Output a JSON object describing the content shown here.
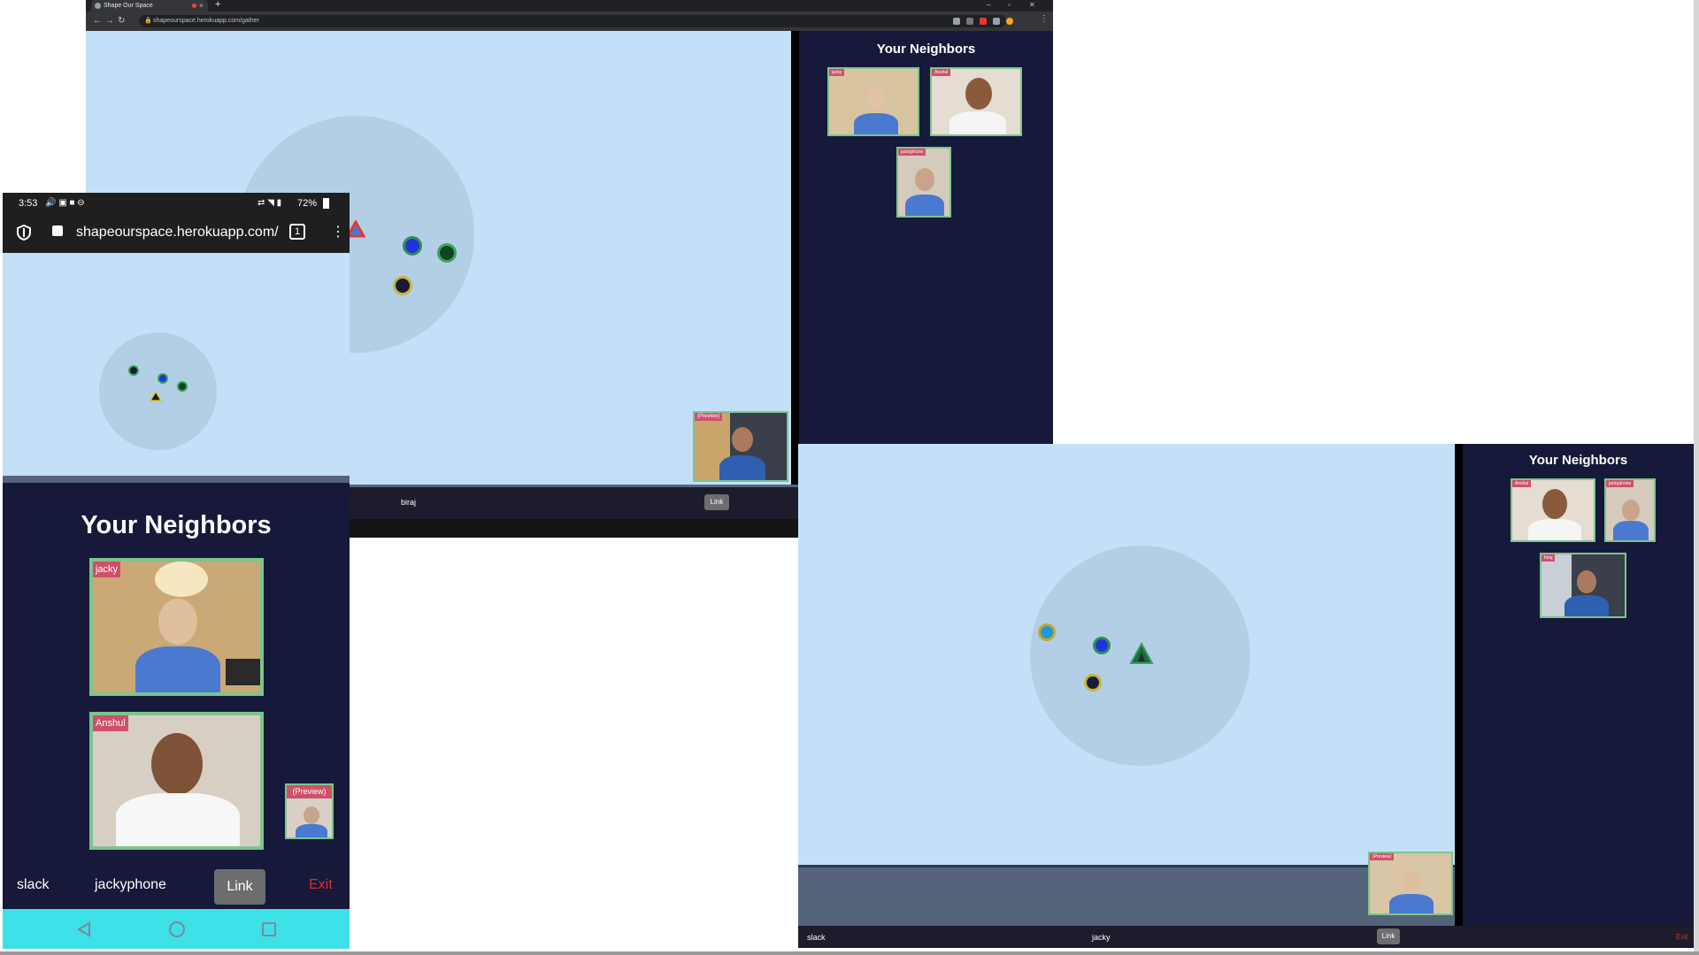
{
  "browser": {
    "tab_title": "Shape Our Space",
    "url": "shapeourspace.herokuapp.com/gather",
    "sidebar_title": "Your Neighbors",
    "neighbors": [
      {
        "name": "jacky"
      },
      {
        "name": "Anshul"
      },
      {
        "name": "jackyphone"
      }
    ],
    "preview_label": "(Preview)",
    "bottom": {
      "name": "biraj",
      "link_label": "Link"
    }
  },
  "phone": {
    "status": {
      "time": "3:53",
      "battery": "72%"
    },
    "url": "shapeourspace.herokuapp.com/",
    "tab_count": "1",
    "sidebar_title": "Your Neighbors",
    "neighbors": [
      {
        "name": "jacky"
      },
      {
        "name": "Anshul"
      }
    ],
    "preview_label": "(Preview)",
    "bottom": {
      "left": "slack",
      "name": "jackyphone",
      "link_label": "Link",
      "exit_label": "Exit"
    }
  },
  "right_window": {
    "sidebar_title": "Your Neighbors",
    "neighbors": [
      {
        "name": "Anshul"
      },
      {
        "name": "jackyphone"
      },
      {
        "name": "biraj"
      }
    ],
    "preview_label": "(Preview)",
    "bottom": {
      "left": "slack",
      "name": "jacky",
      "link_label": "Link",
      "exit_label": "Exit"
    }
  },
  "colors": {
    "map_bg": "#c4e0f9",
    "zone": "#b3cfe6",
    "sidebar_bg": "#16193a",
    "video_border": "#7dc48e",
    "tag_bg": "#d0506a",
    "exit": "#e02b2b",
    "android_nav": "#3ee0e8"
  }
}
